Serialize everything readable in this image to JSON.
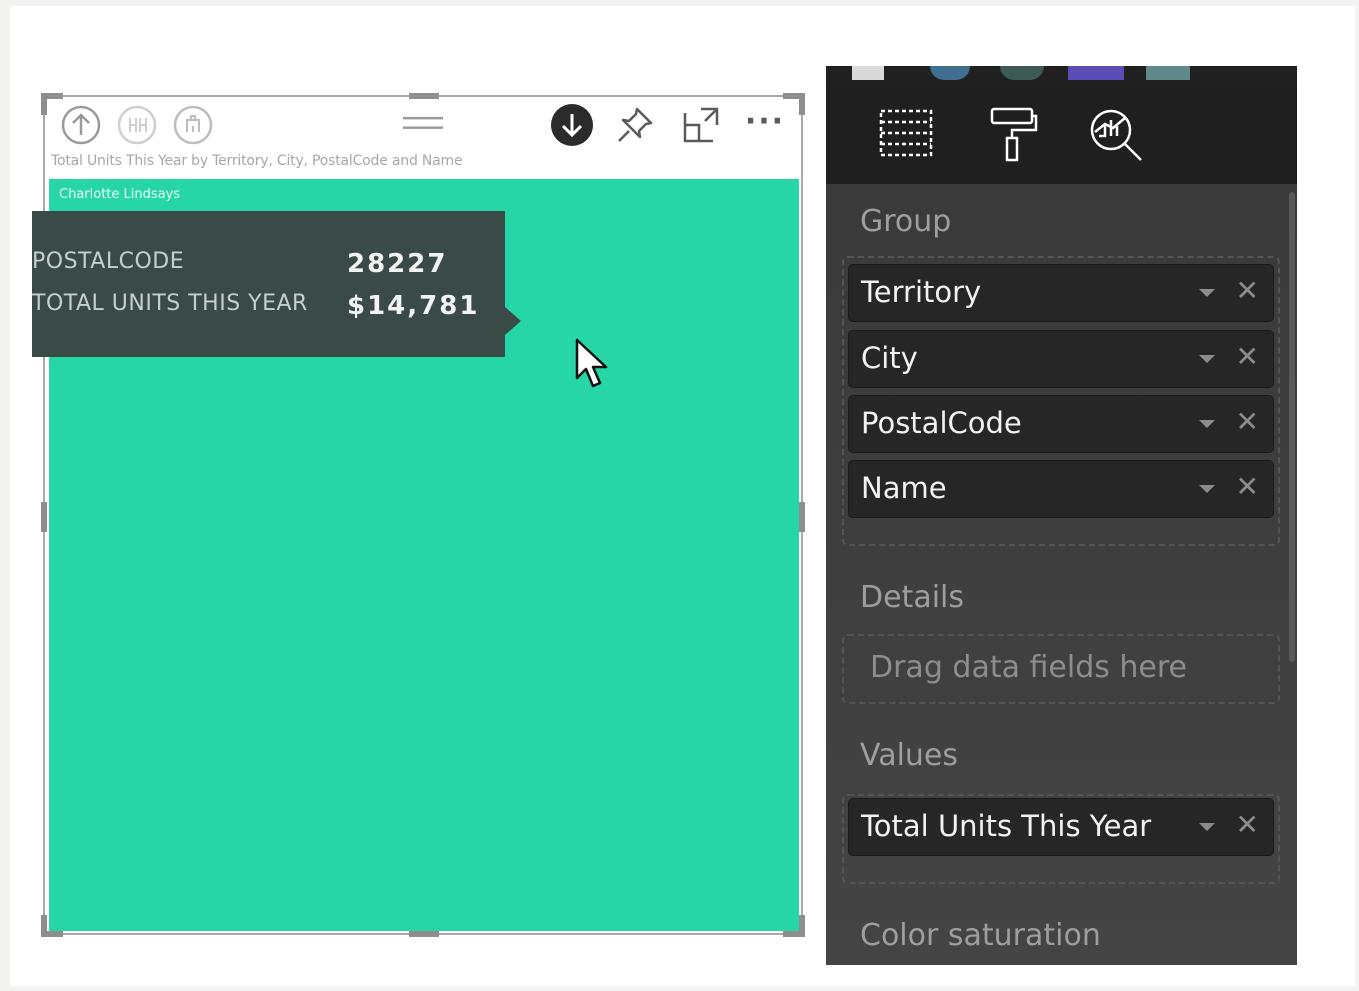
{
  "visual": {
    "title": "Total Units This Year by Territory, City, PostalCode and Name",
    "tile_label": "Charlotte Lindsays",
    "tile_color": "#27d6a6",
    "toolbar_icons": [
      "drill-up-icon",
      "expand-all-icon",
      "drill-down-level-icon",
      "drag-handle-icon",
      "drill-mode-icon",
      "pin-icon",
      "focus-mode-icon",
      "more-options-icon"
    ],
    "more_label": "···",
    "tooltip": {
      "rows": [
        {
          "key": "POSTALCODE",
          "value": "28227"
        },
        {
          "key": "TOTAL UNITS THIS YEAR",
          "value": "$14,781"
        }
      ]
    }
  },
  "pane": {
    "tabs": [
      "fields-tab-icon",
      "format-tab-icon",
      "analytics-tab-icon"
    ],
    "active_tab": "fields-tab-icon",
    "accent_color": "#e8a33a",
    "group": {
      "label": "Group",
      "fields": [
        "Territory",
        "City",
        "PostalCode",
        "Name"
      ]
    },
    "details": {
      "label": "Details",
      "placeholder": "Drag data fields here"
    },
    "values": {
      "label": "Values",
      "fields": [
        "Total Units This Year"
      ]
    },
    "color_saturation": {
      "label": "Color saturation"
    },
    "remove_glyph": "✕"
  }
}
